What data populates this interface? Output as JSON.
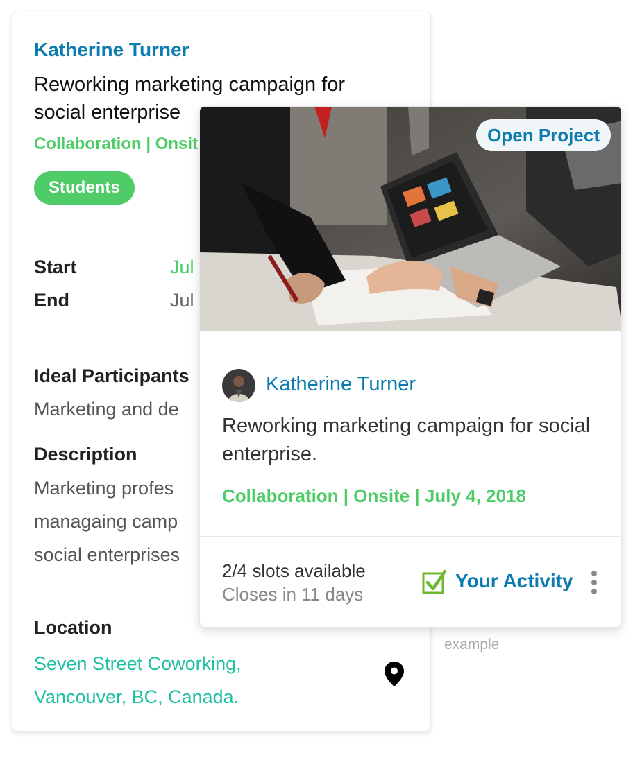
{
  "back_card": {
    "name": "Katherine Turner",
    "title": "Reworking marketing campaign for social enterprise",
    "tags": "Collaboration  |  Onsite",
    "pill": "Students",
    "start_label": "Start",
    "start_value": "Jul",
    "end_label": "End",
    "end_value": "Jul",
    "participants_label": "Ideal Participants",
    "participants_value": "Marketing and de",
    "description_label": "Description",
    "description_lines": [
      "Marketing profes",
      "managaing camp",
      "social enterprises"
    ],
    "location_label": "Location",
    "location_line1": "Seven Street Coworking,",
    "location_line2": "Vancouver, BC, Canada."
  },
  "front_card": {
    "open_project": "Open Project",
    "name": "Katherine Turner",
    "title": "Reworking marketing campaign for social enterprise.",
    "tags": "Collaboration  |  Onsite  |  July 4, 2018",
    "slots": "2/4 slots available",
    "closes": "Closes in 11 days",
    "activity": "Your Activity"
  },
  "caption": "example",
  "colors": {
    "link_blue": "#0b7bb0",
    "green": "#4dcc67",
    "teal": "#20c0a3"
  },
  "icons": {
    "pin": "location-pin-icon",
    "check": "checkbox-checked-icon",
    "menu": "more-vertical-icon"
  }
}
